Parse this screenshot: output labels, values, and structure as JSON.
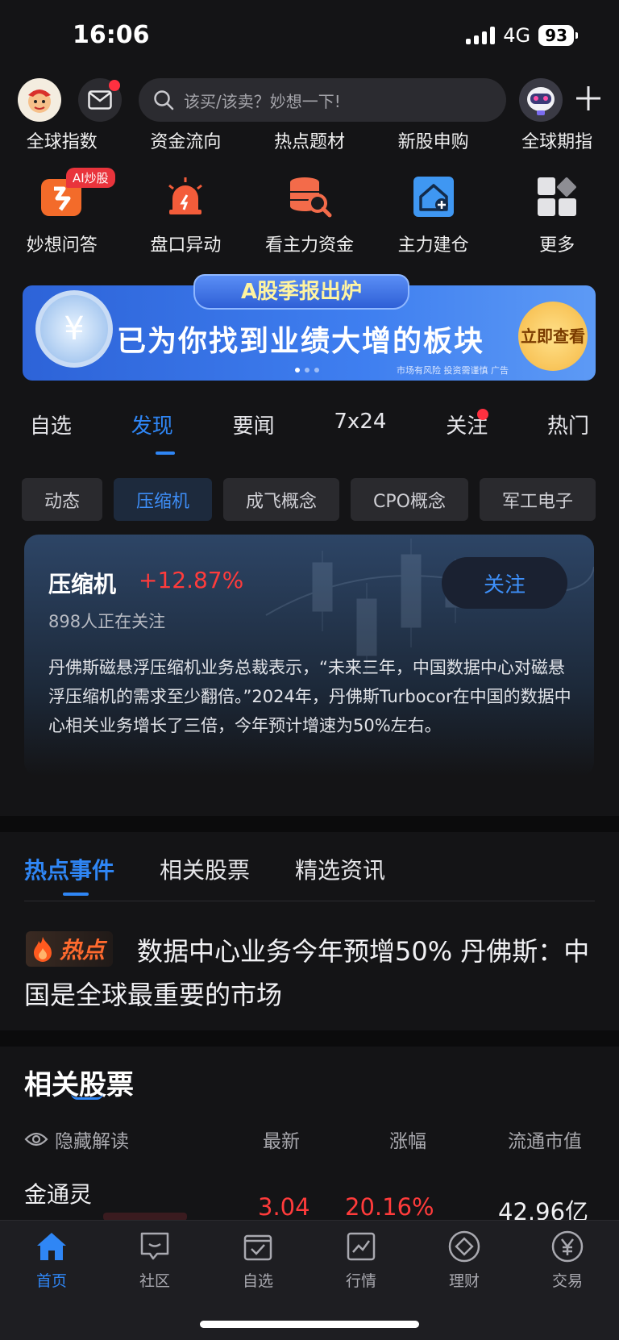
{
  "status_bar": {
    "time": "16:06",
    "network": "4G",
    "battery": "93"
  },
  "header": {
    "search_placeholder": "该买/该卖？妙想一下!"
  },
  "quick_nav_row1": [
    "全球指数",
    "资金流向",
    "热点题材",
    "新股申购",
    "全球期指"
  ],
  "quick_nav_row2": [
    {
      "label": "妙想问答",
      "icon": "ai-chat-icon"
    },
    {
      "label": "盘口异动",
      "icon": "alarm-icon"
    },
    {
      "label": "看主力资金",
      "icon": "database-search-icon"
    },
    {
      "label": "主力建仓",
      "icon": "house-plus-icon"
    },
    {
      "label": "更多",
      "icon": "grid-icon"
    }
  ],
  "ai_badge": "AI炒股",
  "banner": {
    "tag": "A股季报出炉",
    "main": "已为你找到业绩大增的板块",
    "cta": "立即查看",
    "risk": "市场有风险 投资需谨慎 广告"
  },
  "main_tabs": [
    "自选",
    "发现",
    "要闻",
    "7x24",
    "关注",
    "热门"
  ],
  "main_tab_active": "发现",
  "chips": [
    "动态",
    "压缩机",
    "成飞概念",
    "CPO概念",
    "军工电子"
  ],
  "chip_active": "压缩机",
  "concept_card": {
    "title": "压缩机",
    "change": "+12.87%",
    "followers": "898人正在关注",
    "follow_button": "关注",
    "description": "丹佛斯磁悬浮压缩机业务总裁表示，“未来三年，中国数据中心对磁悬浮压缩机的需求至少翻倍。”2024年，丹佛斯Turbocor在中国的数据中心相关业务增长了三倍，今年预计增速为50%左右。"
  },
  "sub_tabs": [
    "热点事件",
    "相关股票",
    "精选资讯"
  ],
  "sub_tab_active": "热点事件",
  "hot_event": {
    "badge": "热点",
    "text": "数据中心业务今年预增50% 丹佛斯：中国是全球最重要的市场"
  },
  "related_stocks": {
    "title": "相关股票",
    "columns": {
      "hide": "隐藏解读",
      "latest": "最新",
      "change": "涨幅",
      "market_cap": "流通市值"
    },
    "rows": [
      {
        "name": "金通灵",
        "latest": "3.04",
        "change": "20.16%",
        "market_cap": "42.96亿"
      }
    ]
  },
  "bottom_nav": [
    {
      "label": "首页",
      "icon": "home-icon"
    },
    {
      "label": "社区",
      "icon": "chat-bubble-icon"
    },
    {
      "label": "自选",
      "icon": "checkbox-icon"
    },
    {
      "label": "行情",
      "icon": "chart-icon"
    },
    {
      "label": "理财",
      "icon": "diamond-icon"
    },
    {
      "label": "交易",
      "icon": "yen-coin-icon"
    }
  ],
  "colors": {
    "accent": "#2f86f5",
    "up": "#ff3b3b",
    "background": "#141416"
  }
}
